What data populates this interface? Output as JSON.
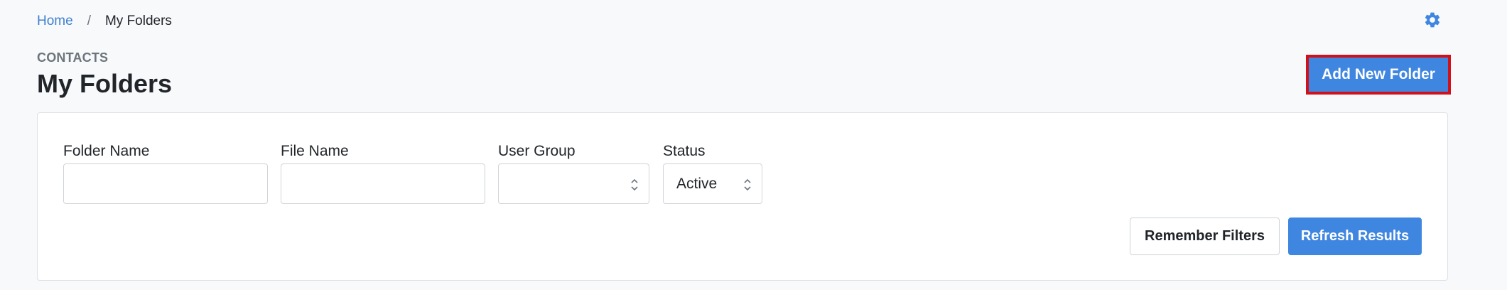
{
  "breadcrumb": {
    "home": "Home",
    "separator": "/",
    "current": "My Folders"
  },
  "header": {
    "eyebrow": "CONTACTS",
    "title": "My Folders",
    "add_button": "Add New Folder"
  },
  "filters": {
    "folder_name": {
      "label": "Folder Name",
      "value": "",
      "placeholder": ""
    },
    "file_name": {
      "label": "File Name",
      "value": "",
      "placeholder": ""
    },
    "user_group": {
      "label": "User Group",
      "selected": ""
    },
    "status": {
      "label": "Status",
      "selected": "Active"
    }
  },
  "actions": {
    "remember_filters": "Remember Filters",
    "refresh_results": "Refresh Results"
  },
  "icons": {
    "settings": "gear-icon",
    "select_chevron": "chevron-up-down-icon"
  },
  "colors": {
    "accent": "#3f86e0",
    "link": "#3f7fcf",
    "highlight_border": "#d0101a"
  }
}
